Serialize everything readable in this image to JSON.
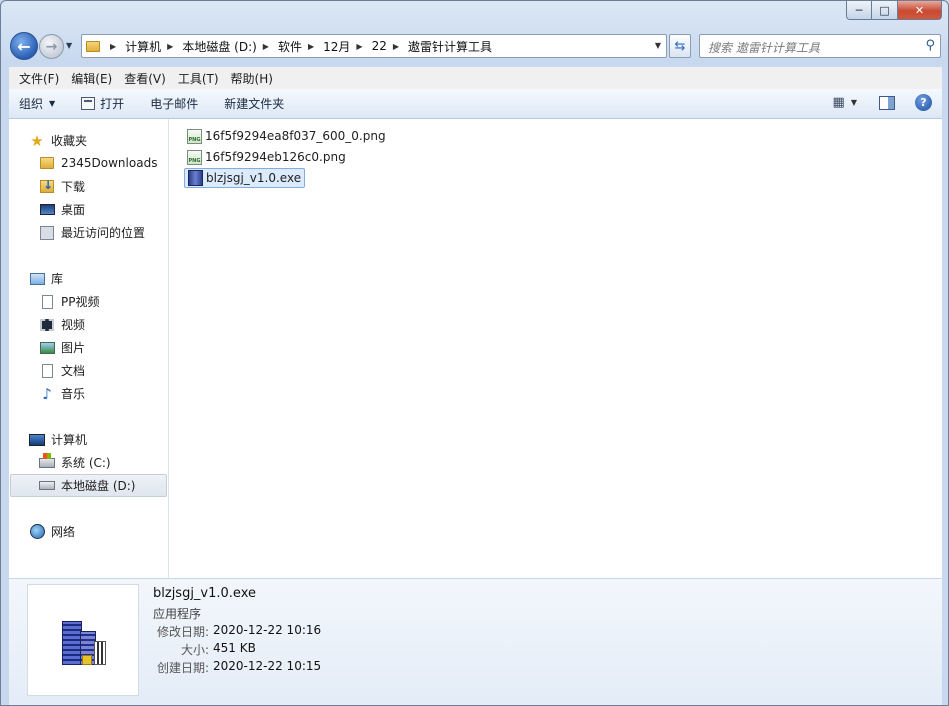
{
  "window": {
    "caption_min": "─",
    "caption_max": "□",
    "caption_close": "✕"
  },
  "address": {
    "crumbs": [
      "计算机",
      "本地磁盘 (D:)",
      "软件",
      "12月",
      "22",
      "遨雷针计算工具"
    ]
  },
  "search": {
    "placeholder": "搜索 遨雷针计算工具"
  },
  "menu": [
    "文件(F)",
    "编辑(E)",
    "查看(V)",
    "工具(T)",
    "帮助(H)"
  ],
  "commands": {
    "organize": "组织",
    "open": "打开",
    "email": "电子邮件",
    "new_folder": "新建文件夹"
  },
  "nav": {
    "favorites": "收藏夹",
    "downloads2345": "2345Downloads",
    "downloads": "下载",
    "desktop": "桌面",
    "recent": "最近访问的位置",
    "libraries": "库",
    "pp_video": "PP视频",
    "video": "视频",
    "pictures": "图片",
    "documents": "文档",
    "music": "音乐",
    "computer": "计算机",
    "drive_c": "系统 (C:)",
    "drive_d": "本地磁盘 (D:)",
    "network": "网络"
  },
  "files": [
    {
      "name": "16f5f9294ea8f037_600_0.png",
      "type": "png",
      "selected": false
    },
    {
      "name": "16f5f9294eb126c0.png",
      "type": "png",
      "selected": false
    },
    {
      "name": "blzjsgj_v1.0.exe",
      "type": "exe",
      "selected": true
    }
  ],
  "details": {
    "name": "blzjsgj_v1.0.exe",
    "type": "应用程序",
    "modified_label": "修改日期:",
    "modified_value": "2020-12-22 10:16",
    "size_label": "大小:",
    "size_value": "451 KB",
    "created_label": "创建日期:",
    "created_value": "2020-12-22 10:15"
  }
}
